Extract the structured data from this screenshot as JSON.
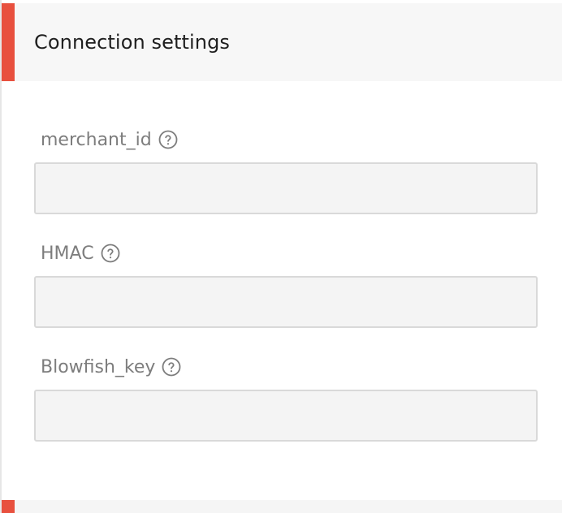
{
  "section": {
    "title": "Connection settings"
  },
  "fields": [
    {
      "label": "merchant_id",
      "value": "",
      "placeholder": ""
    },
    {
      "label": "HMAC",
      "value": "",
      "placeholder": ""
    },
    {
      "label": "Blowfish_key",
      "value": "",
      "placeholder": ""
    }
  ],
  "icons": {
    "help": "help-circle-icon"
  },
  "colors": {
    "accent": "#e8503e",
    "header_bg": "#f7f7f7",
    "input_bg": "#f4f4f4",
    "input_border": "#d9d9d9",
    "label_text": "#7d7d7d"
  }
}
